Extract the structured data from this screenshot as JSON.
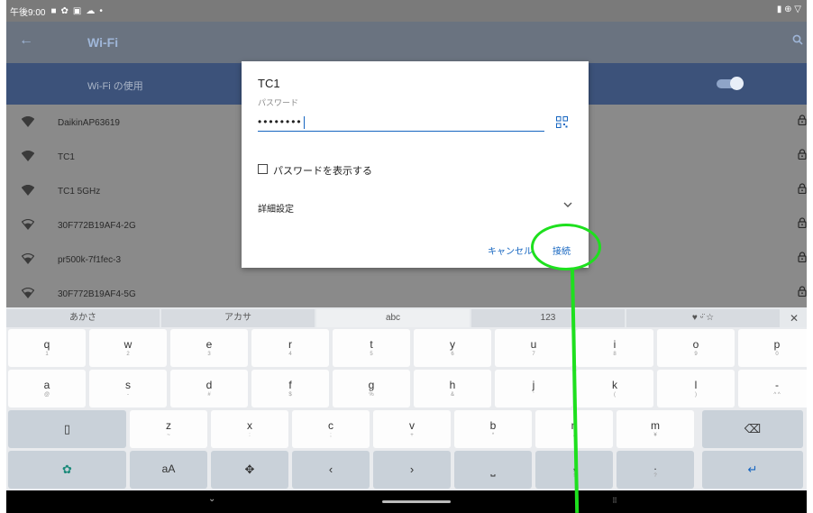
{
  "status_bar": {
    "time": "午後9:00",
    "icons": [
      "image-icon",
      "gear-icon",
      "photo-icon",
      "cloud-icon",
      "dot-icon"
    ],
    "right_icons": [
      "battery-icon",
      "vpn-icon",
      "wifi-status-icon"
    ]
  },
  "app_bar": {
    "title": "Wi-Fi",
    "back_icon": "back-arrow-icon",
    "search_icon": "search-icon"
  },
  "wifi_toggle": {
    "label": "Wi-Fi の使用",
    "on": true
  },
  "networks": [
    {
      "ssid": "DaikinAP63619",
      "locked": true,
      "signal": "full"
    },
    {
      "ssid": "TC1",
      "locked": true,
      "signal": "full"
    },
    {
      "ssid": "TC1 5GHz",
      "locked": true,
      "signal": "full"
    },
    {
      "ssid": "30F772B19AF4-2G",
      "locked": true,
      "signal": "medium"
    },
    {
      "ssid": "pr500k-7f1fec-3",
      "locked": true,
      "signal": "medium"
    },
    {
      "ssid": "30F772B19AF4-5G",
      "locked": true,
      "signal": "low"
    }
  ],
  "dialog": {
    "title": "TC1",
    "password_label": "パスワード",
    "password_value": "••••••••",
    "qr_icon": "qr-scan-icon",
    "show_password_label": "パスワードを表示する",
    "show_password_checked": false,
    "advanced_label": "詳細設定",
    "chevron_icon": "chevron-down-icon",
    "cancel_label": "キャンセル",
    "connect_label": "接続"
  },
  "annotation": {
    "color": "#1ee01e"
  },
  "keyboard": {
    "tabs": [
      "あかさ",
      "アカサ",
      "abc",
      "123",
      "♥ ᵕ̈ ☆"
    ],
    "active_tab": "abc",
    "close_icon": "close-icon",
    "rows": [
      [
        {
          "main": "q",
          "sub": "1"
        },
        {
          "main": "w",
          "sub": "2"
        },
        {
          "main": "e",
          "sub": "3"
        },
        {
          "main": "r",
          "sub": "4"
        },
        {
          "main": "t",
          "sub": "5"
        },
        {
          "main": "y",
          "sub": "6"
        },
        {
          "main": "u",
          "sub": "7"
        },
        {
          "main": "i",
          "sub": "8"
        },
        {
          "main": "o",
          "sub": "9"
        },
        {
          "main": "p",
          "sub": "0"
        }
      ],
      [
        {
          "main": "a",
          "sub": "@"
        },
        {
          "main": "s",
          "sub": "-"
        },
        {
          "main": "d",
          "sub": "#"
        },
        {
          "main": "f",
          "sub": "$"
        },
        {
          "main": "g",
          "sub": "%"
        },
        {
          "main": "h",
          "sub": "&"
        },
        {
          "main": "j",
          "sub": "'"
        },
        {
          "main": "k",
          "sub": "("
        },
        {
          "main": "l",
          "sub": ")"
        },
        {
          "main": "-",
          "sub": "^ ^"
        }
      ],
      [
        {
          "main": "z",
          "sub": "~"
        },
        {
          "main": "x",
          "sub": ":"
        },
        {
          "main": "c",
          "sub": ";"
        },
        {
          "main": "v",
          "sub": "+"
        },
        {
          "main": "b",
          "sub": "*"
        },
        {
          "main": "n",
          "sub": "/"
        },
        {
          "main": "m",
          "sub": "¥"
        }
      ],
      [
        {
          "main": "aA",
          "sub": ""
        },
        {
          "main": ",",
          "sub": "!"
        },
        {
          "main": ".",
          "sub": "?"
        }
      ]
    ],
    "icons": {
      "device": "device-icon",
      "backspace": "backspace-icon",
      "settings": "settings-gear-icon",
      "cursor": "cursor-move-icon",
      "left": "arrow-left-icon",
      "right": "arrow-right-icon",
      "space": "space-icon",
      "enter": "enter-icon"
    }
  },
  "nav_bar": {
    "icons": [
      "nav-hide-keyboard-icon",
      "home-pill-icon",
      "keyboard-switch-icon"
    ]
  }
}
